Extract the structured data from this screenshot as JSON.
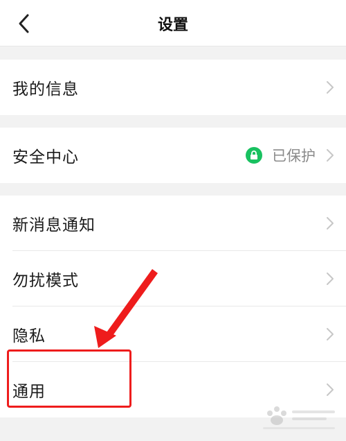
{
  "header": {
    "title": "设置",
    "back_icon": "chevron-left-icon"
  },
  "settings": {
    "group1": [
      {
        "label": "我的信息"
      }
    ],
    "group2": [
      {
        "label": "安全中心",
        "status": "已保护",
        "status_icon": "lock-icon",
        "status_color": "#19c160"
      }
    ],
    "group3": [
      {
        "label": "新消息通知"
      },
      {
        "label": "勿扰模式"
      },
      {
        "label": "隐私"
      },
      {
        "label": "通用"
      }
    ]
  },
  "annotation": {
    "color": "#ee1c1c",
    "target": "通用"
  },
  "colors": {
    "background": "#f2f2f2",
    "card": "#ffffff",
    "chevron": "#c7c7c7",
    "status_text": "#8a8a8a"
  }
}
